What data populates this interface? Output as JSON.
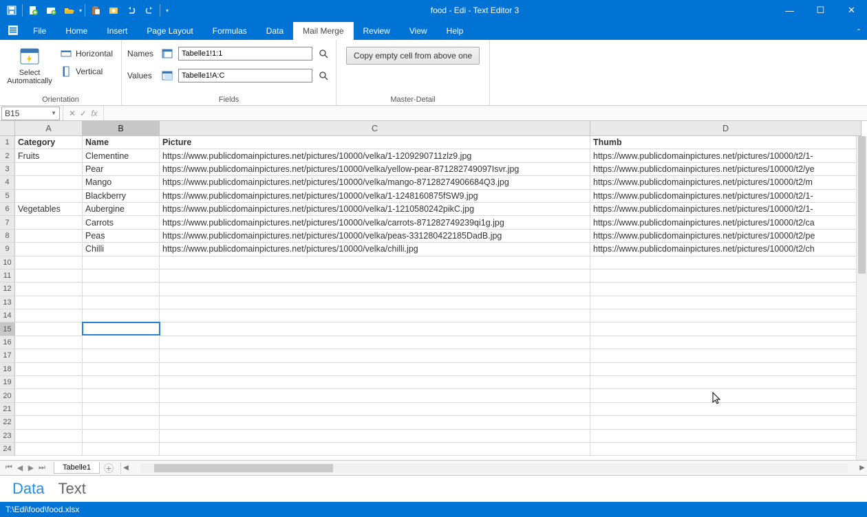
{
  "window": {
    "title": "food - Edi - Text Editor 3"
  },
  "menu": {
    "tabs": [
      "File",
      "Home",
      "Insert",
      "Page Layout",
      "Formulas",
      "Data",
      "Mail Merge",
      "Review",
      "View",
      "Help"
    ],
    "active_index": 6
  },
  "ribbon": {
    "orientation": {
      "label": "Orientation",
      "select_auto": "Select Automatically",
      "horizontal": "Horizontal",
      "vertical": "Vertical"
    },
    "fields": {
      "label": "Fields",
      "names_lbl": "Names",
      "names_val": "Tabelle1!1:1",
      "values_lbl": "Values",
      "values_val": "Tabelle1!A:C"
    },
    "master": {
      "label": "Master-Detail",
      "btn": "Copy empty cell from above one"
    }
  },
  "namebox": "B15",
  "columns": [
    "A",
    "B",
    "C",
    "D"
  ],
  "col_selected": 1,
  "row_selected": 15,
  "headers": [
    "Category",
    "Name",
    "Picture",
    "Thumb"
  ],
  "rows": [
    [
      "Fruits",
      "Clementine",
      "https://www.publicdomainpictures.net/pictures/10000/velka/1-1209290711zlz9.jpg",
      "https://www.publicdomainpictures.net/pictures/10000/t2/1-"
    ],
    [
      "",
      "Pear",
      "https://www.publicdomainpictures.net/pictures/10000/velka/yellow-pear-871282749097Isvr.jpg",
      "https://www.publicdomainpictures.net/pictures/10000/t2/ye"
    ],
    [
      "",
      "Mango",
      "https://www.publicdomainpictures.net/pictures/10000/velka/mango-87128274906684Q3.jpg",
      "https://www.publicdomainpictures.net/pictures/10000/t2/m"
    ],
    [
      "",
      "Blackberry",
      "https://www.publicdomainpictures.net/pictures/10000/velka/1-1248160875fSW9.jpg",
      "https://www.publicdomainpictures.net/pictures/10000/t2/1-"
    ],
    [
      "Vegetables",
      "Aubergine",
      "https://www.publicdomainpictures.net/pictures/10000/velka/1-1210580242pikC.jpg",
      "https://www.publicdomainpictures.net/pictures/10000/t2/1-"
    ],
    [
      "",
      "Carrots",
      "https://www.publicdomainpictures.net/pictures/10000/velka/carrots-871282749239qi1g.jpg",
      "https://www.publicdomainpictures.net/pictures/10000/t2/ca"
    ],
    [
      "",
      "Peas",
      "https://www.publicdomainpictures.net/pictures/10000/velka/peas-331280422185DadB.jpg",
      "https://www.publicdomainpictures.net/pictures/10000/t2/pe"
    ],
    [
      "",
      "Chilli",
      "https://www.publicdomainpictures.net/pictures/10000/velka/chilli.jpg",
      "https://www.publicdomainpictures.net/pictures/10000/t2/ch"
    ]
  ],
  "total_rows": 24,
  "sheet_tab": "Tabelle1",
  "lower_tabs": {
    "data": "Data",
    "text": "Text",
    "active": 0
  },
  "status_path": "T:\\Edi\\food\\food.xlsx"
}
